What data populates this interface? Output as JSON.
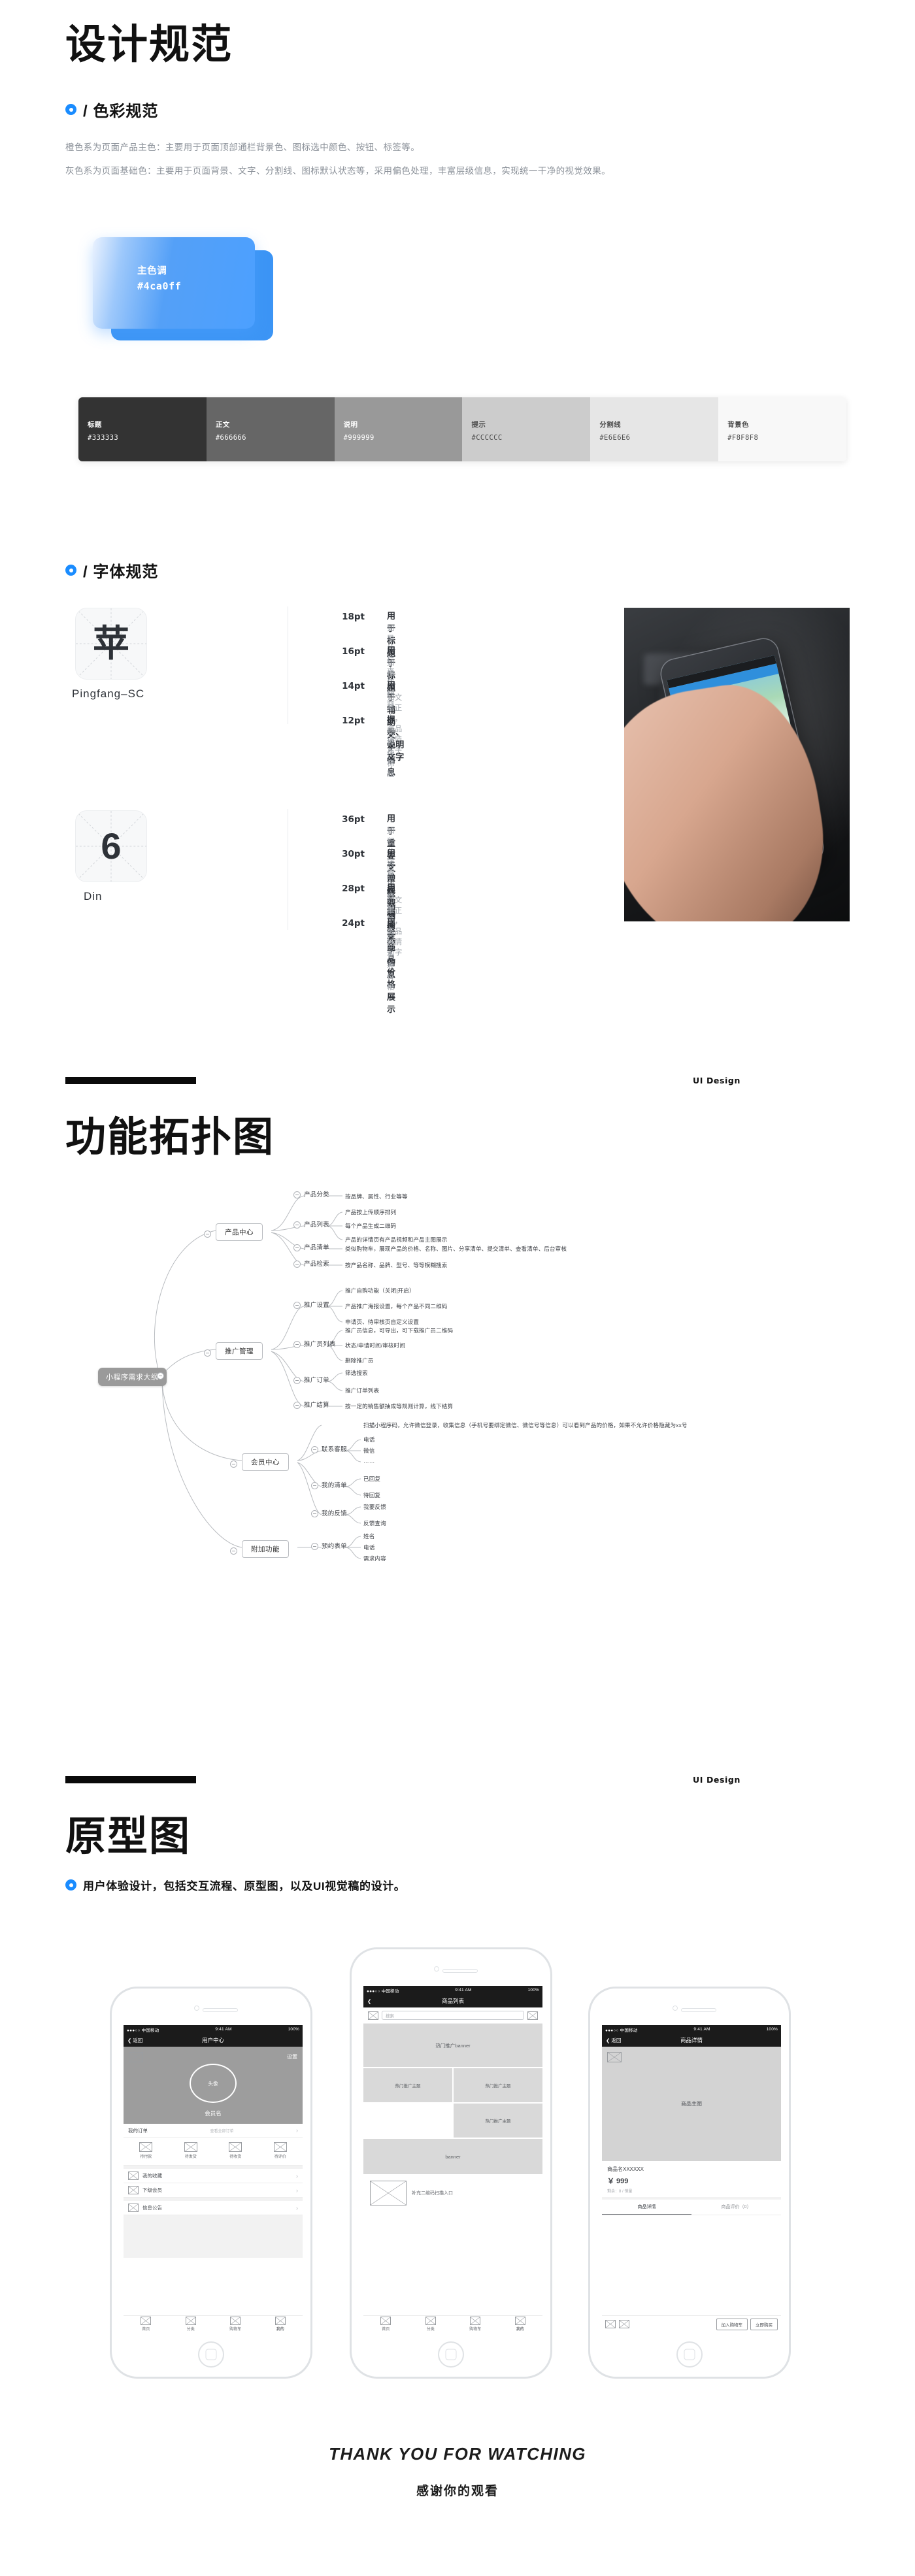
{
  "design_spec": {
    "title": "设计规范",
    "color_section": {
      "label": "/ 色彩规范",
      "paragraphs": [
        "橙色系为页面产品主色：主要用于页面顶部通栏背景色、图标选中颜色、按钮、标签等。",
        "灰色系为页面基础色：主要用于页面背景、文字、分割线、图标默认状态等，采用偏色处理，丰富层级信息，实现统一干净的视觉效果。"
      ],
      "primary_swatch": {
        "name": "主色调",
        "hex": "#4ca0ff"
      },
      "gray_palette": [
        {
          "name": "标题",
          "hex": "#333333",
          "bg": "#333333",
          "text": "#ffffff"
        },
        {
          "name": "正文",
          "hex": "#666666",
          "bg": "#666666",
          "text": "#ffffff"
        },
        {
          "name": "说明",
          "hex": "#999999",
          "bg": "#999999",
          "text": "#ffffff"
        },
        {
          "name": "提示",
          "hex": "#CCCCCC",
          "bg": "#CCCCCC",
          "text": "#4a4a4a"
        },
        {
          "name": "分割线",
          "hex": "#E6E6E6",
          "bg": "#E6E6E6",
          "text": "#4a4a4a"
        },
        {
          "name": "背景色",
          "hex": "#F8F8F8",
          "bg": "#F8F8F8",
          "text": "#4a4a4a"
        }
      ]
    },
    "type_section": {
      "label": "/ 字体规范",
      "fonts": [
        {
          "glyph": "苹",
          "name": "Pingfang–SC",
          "rows": [
            {
              "size": "18pt",
              "use": "用于标题",
              "example": "如导航栏大标题"
            },
            {
              "size": "16pt",
              "use": "用于标题",
              "example": "如模块标题"
            },
            {
              "size": "14pt",
              "use": "用于辅助文字信息",
              "example": "如文章正文，商品详情文字等"
            },
            {
              "size": "12pt",
              "use": "提示、说明文字",
              "example": "如模块标题"
            }
          ]
        },
        {
          "glyph": "6",
          "name": "Din",
          "rows": [
            {
              "size": "36pt",
              "use": "用于重要文字数据",
              "example": "如积分详情页大数据显示"
            },
            {
              "size": "30pt",
              "use": "用于常规数据展示",
              "example": "商品详情价格"
            },
            {
              "size": "28pt",
              "use": "用于辅助文字信息",
              "example": "如文章正文，商品详情文字等"
            },
            {
              "size": "24pt",
              "use": "用于商品价格展示",
              "example": "商品列表价格"
            }
          ]
        }
      ]
    }
  },
  "topology": {
    "band_tag": "UI Design",
    "title": "功能拓扑图",
    "root": "小程序需求大纲",
    "branches": [
      {
        "name": "产品中心",
        "children": [
          {
            "name": "产品分类",
            "leaves": [
              "按品牌、属性、行业等等"
            ]
          },
          {
            "name": "产品列表",
            "leaves": [
              "产品按上传顺序排列",
              "每个产品生成二维码",
              "产品的详情页有产品视频和产品主图展示"
            ]
          },
          {
            "name": "产品清单",
            "leaves": [
              "类似购物车，展现产品的价格、名称、图片、分享清单、提交清单、查看清单、后台审核"
            ]
          },
          {
            "name": "产品检索",
            "leaves": [
              "按产品名称、品牌、型号、等等模糊搜索"
            ]
          }
        ]
      },
      {
        "name": "推广管理",
        "children": [
          {
            "name": "推广设置",
            "leaves": [
              "推广自购功能（关闭|开启）",
              "产品推广海报设置，每个产品不同二维码",
              "申请页、待审核页自定义设置"
            ]
          },
          {
            "name": "推广员列表",
            "leaves": [
              "推广员信息，可导出，可下载推广员二维码",
              "状态/申请时间/审核时间",
              "删除推广员"
            ]
          },
          {
            "name": "推广订单",
            "leaves": [
              "筛选搜索",
              "推广订单列表"
            ]
          },
          {
            "name": "推广结算",
            "leaves": [
              "按一定的销售额抽成等规则计算，线下结算"
            ]
          }
        ]
      },
      {
        "name": "会员中心",
        "children": [
          {
            "name": "",
            "leaves": [
              "扫描小程序码，允许微信登录，收集信息（手机号要绑定微信、微信号等信息）可以看到产品的价格，如果不允许价格隐藏为xx号"
            ]
          },
          {
            "name": "联系客服",
            "leaves": [
              "电话",
              "微信",
              "……"
            ]
          },
          {
            "name": "我的清单",
            "leaves": [
              "已回复",
              "待回复"
            ]
          },
          {
            "name": "我的反馈",
            "leaves": [
              "我要反馈",
              "反馈查询"
            ]
          }
        ]
      },
      {
        "name": "附加功能",
        "children": [
          {
            "name": "预约表单",
            "leaves": [
              "姓名",
              "电话",
              "需求内容"
            ]
          }
        ]
      }
    ]
  },
  "prototype": {
    "band_tag": "UI Design",
    "title": "原型图",
    "subtitle": "用户体验设计，包括交互流程、原型图，以及UI视觉稿的设计。",
    "screens": [
      {
        "status": {
          "carrier": "●●●○○ 中国移动",
          "wifi": "令",
          "time": "9:41 AM",
          "battery": "100%"
        },
        "navbar": {
          "back": "❮ 返回",
          "title": "用户中心",
          "right": ""
        },
        "hero": {
          "settings": "设置",
          "avatar": "头像",
          "member": "会员名"
        },
        "order_header": {
          "title": "我的订单",
          "more": "查看全部订单"
        },
        "order_tabs": [
          "待付款",
          "待发货",
          "待收货",
          "待评价"
        ],
        "menu": [
          "我的收藏",
          "下级会员",
          "信息公告"
        ],
        "tabbar": [
          "首页",
          "分类",
          "购物车",
          "我的"
        ]
      },
      {
        "status": {
          "carrier": "●●●○○ 中国移动",
          "wifi": "令",
          "time": "9:41 AM",
          "battery": "100%"
        },
        "navbar": {
          "back": "❮",
          "title": "商品列表",
          "right": ""
        },
        "search_placeholder": "搜索",
        "banner_label": "热门推广banner",
        "grid_labels": [
          "热门推广主题",
          "热门推广主题",
          "热门推广主题"
        ],
        "mid_banner": "banner",
        "qr_label": "补充二维码扫描入口",
        "tabbar": [
          "首页",
          "分类",
          "购物车",
          "我的"
        ]
      },
      {
        "status": {
          "carrier": "●●●○○ 中国移动",
          "wifi": "令",
          "time": "9:41 AM",
          "battery": "100%"
        },
        "navbar": {
          "back": "❮ 返回",
          "title": "商品详情",
          "right": ""
        },
        "main_image_label": "商品主图",
        "product_name": "商品名XXXXXX",
        "price": "￥ 999",
        "stock": "剩余：8 / 销量",
        "tabs": [
          "商品详情",
          "商品评价（0）"
        ],
        "actions": [
          "加入购物车",
          "立即购买"
        ]
      }
    ]
  },
  "footer": {
    "thanks_en": "THANK YOU FOR WATCHING",
    "thanks_cn": "感谢你的观看"
  },
  "colors": {
    "accent_blue": "#1a8cff",
    "primary": "#4ca0ff",
    "ink": "#111111",
    "muted": "#8b9199"
  }
}
